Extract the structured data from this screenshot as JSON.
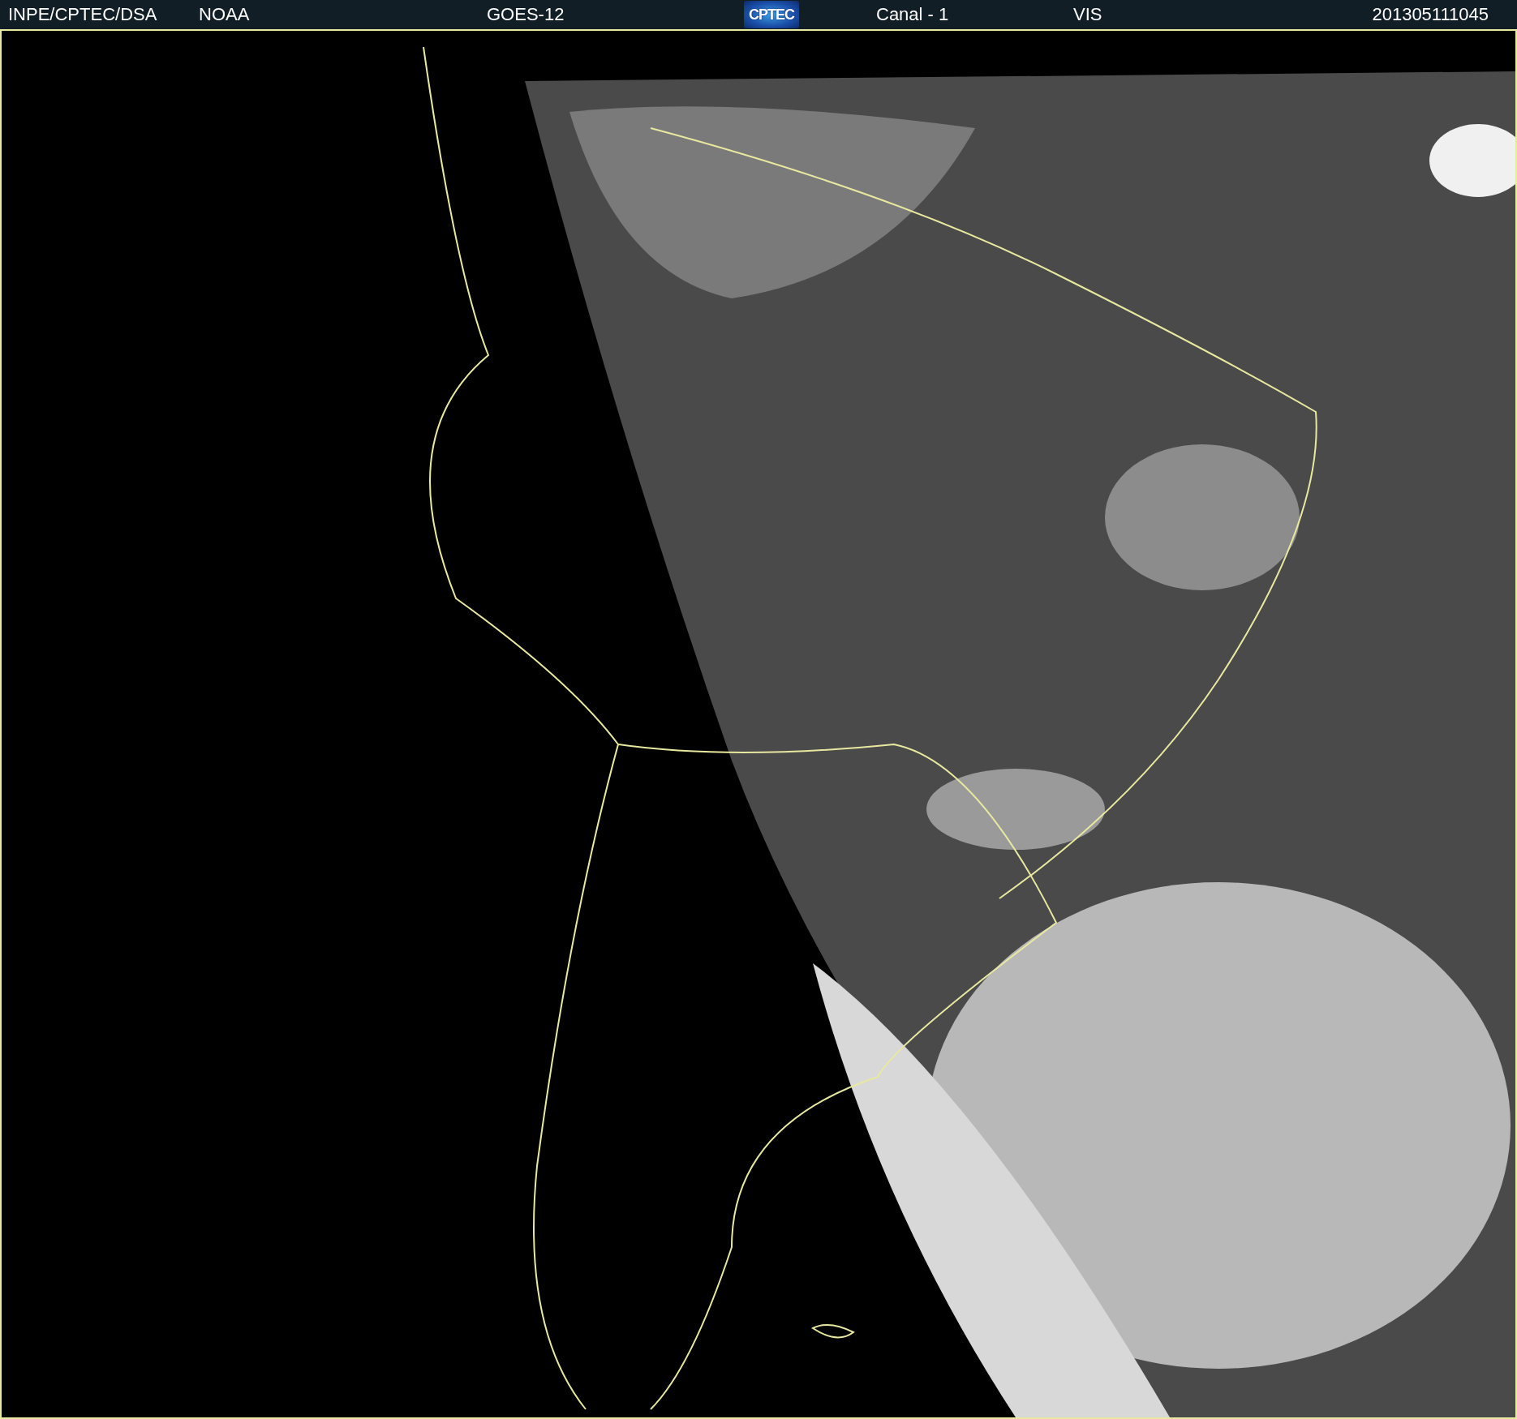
{
  "header": {
    "items": [
      {
        "kind": "text",
        "text": "INPE/CPTEC/DSA"
      },
      {
        "kind": "text",
        "text": "NOAA"
      },
      {
        "kind": "text",
        "text": "GOES-12"
      },
      {
        "kind": "logo",
        "text": "CPTEC"
      },
      {
        "kind": "text",
        "text": "Canal - 1"
      },
      {
        "kind": "text",
        "text": "VIS"
      },
      {
        "kind": "text",
        "text": "201305111045"
      }
    ]
  }
}
